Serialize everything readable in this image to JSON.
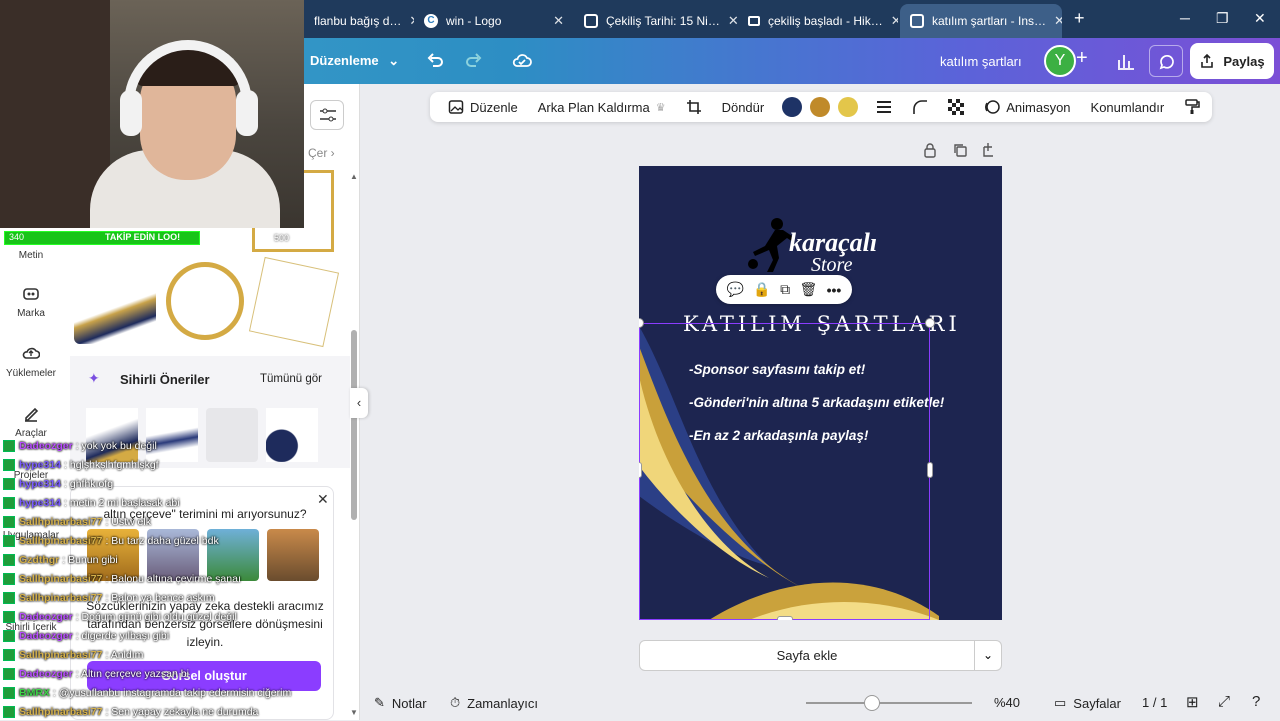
{
  "browser": {
    "tabs": [
      {
        "title": "flanbu bağış d…"
      },
      {
        "title": "win - Logo"
      },
      {
        "title": "Çekiliş Tarihi: 15 Ni…"
      },
      {
        "title": "çekiliş başladı - Hik…"
      },
      {
        "title": "katılım şartları - Ins…"
      }
    ],
    "new_tab": "+",
    "window_controls": [
      "─",
      "❐",
      "✕"
    ]
  },
  "topbar": {
    "edit_menu": "Düzenleme",
    "doc_title": "katılım şartları",
    "avatar": "Y",
    "share": "Paylaş"
  },
  "leftnav": {
    "items": [
      {
        "label": "Metin",
        "icon": "text-icon"
      },
      {
        "label": "Marka",
        "icon": "brand-icon"
      },
      {
        "label": "Yüklemeler",
        "icon": "upload-icon"
      },
      {
        "label": "Araçlar",
        "icon": "draw-icon"
      },
      {
        "label": "Projeler",
        "icon": "folder-icon"
      },
      {
        "label": "Uygulamalar",
        "icon": "apps-icon"
      },
      {
        "label": "Sihirli İçerik",
        "icon": "magic-icon"
      }
    ]
  },
  "panel": {
    "partial_label": "Çer",
    "magic_title": "Sihirli Öneriler",
    "see_all": "Tümünü gör",
    "prompt_question": "altın çerçeve\" terimini mi arıyorsunuz?",
    "prompt_body": "Sözcüklerinizin yapay zeka destekli aracımız tarafından benzersiz görsellere dönüşmesini izleyin.",
    "create_button": "Görsel oluştur"
  },
  "stream": {
    "follow_left": "340",
    "follow_text": "TAKİP EDİN LOO!",
    "follow_right": "500",
    "chat": [
      {
        "user": "Dadeozger",
        "msg": ": yok yok bu değil",
        "color": "#b94dff"
      },
      {
        "user": "hype314",
        "msg": ": hglşhkşlhfgmhlşkgf",
        "color": "#7a5cff"
      },
      {
        "user": "hype314",
        "msg": ": ghfhkıofg",
        "color": "#7a5cff"
      },
      {
        "user": "hype314",
        "msg": ": metin 2 mi başlasak abi",
        "color": "#7a5cff"
      },
      {
        "user": "Sallhpinarbasi77",
        "msg": ": Ustw elk",
        "color": "#d4b04a"
      },
      {
        "user": "Sallhpinarbasi77",
        "msg": ": Bu tarz daha güzel bdk",
        "color": "#d4b04a"
      },
      {
        "user": "Gzdthgr",
        "msg": ": Bunun gibi",
        "color": "#d4b04a"
      },
      {
        "user": "Sallhpinarbasi77",
        "msg": ": Balonu altına çevirme şanaı",
        "color": "#d4b04a"
      },
      {
        "user": "Sallhpinarbasi77",
        "msg": ": Balon ya bence aşkım",
        "color": "#d4b04a"
      },
      {
        "user": "Dadeozger",
        "msg": ": Doğum günü gibi oldu güzel değil",
        "color": "#b94dff"
      },
      {
        "user": "Dadeozger",
        "msg": ": digerde yılbaşı gibi",
        "color": "#b94dff"
      },
      {
        "user": "Sallhpinarbasi77",
        "msg": ": Anldım",
        "color": "#d4b04a"
      },
      {
        "user": "Dadeozger",
        "msg": ": Altın çerçeve yazsan bi",
        "color": "#b94dff"
      },
      {
        "user": "BMRX",
        "msg": ": @yusuflanbu instagramda takip edermisin ciğerim",
        "color": "#3fd44a"
      },
      {
        "user": "Sallhpinarbasi77",
        "msg": ": Sen yapay zekayla ne durumda",
        "color": "#d4b04a"
      }
    ]
  },
  "ctxbar": {
    "edit": "Düzenle",
    "bg_remove": "Arka Plan Kaldırma",
    "rotate": "Döndür",
    "colors": [
      "#1e3366",
      "#c08a2a",
      "#e3c64a"
    ],
    "animate": "Animasyon",
    "position": "Konumlandır"
  },
  "design": {
    "brand_line1": "karaçalı",
    "brand_line2": "Store",
    "heading": "KATILIM ŞARTLARI",
    "rules": [
      "-Sponsor sayfasını takip et!",
      "-Gönderi'nin altına 5 arkadaşını etiketle!",
      "-En az 2 arkadaşınla paylaş!"
    ]
  },
  "add_page": "Sayfa ekle",
  "bottom": {
    "notes": "Notlar",
    "timer": "Zamanlayıcı",
    "zoom": "%40",
    "zoom_level": 0.4,
    "pages_label": "Sayfalar",
    "page_count": "1 / 1"
  }
}
